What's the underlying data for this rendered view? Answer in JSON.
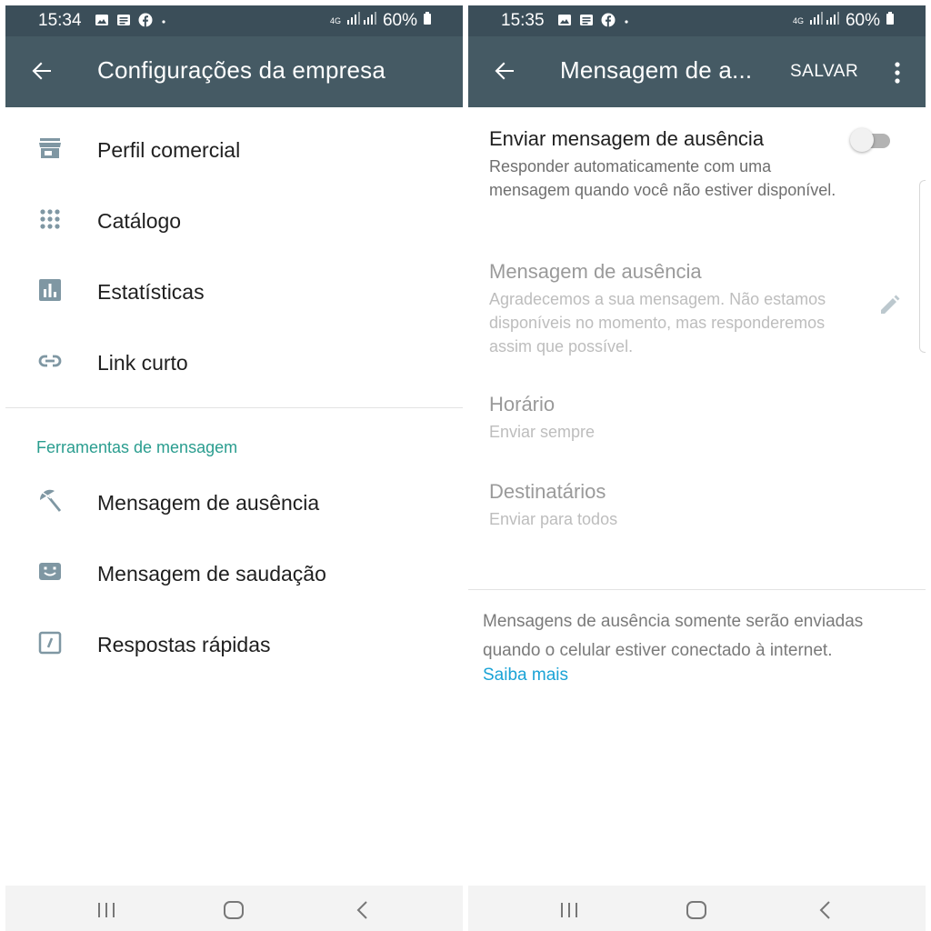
{
  "left": {
    "status": {
      "time": "15:34",
      "network": "4G",
      "battery": "60%"
    },
    "appbar": {
      "title": "Configurações da empresa"
    },
    "items": [
      {
        "label": "Perfil comercial",
        "icon": "store-icon"
      },
      {
        "label": "Catálogo",
        "icon": "grid-icon"
      },
      {
        "label": "Estatísticas",
        "icon": "bar-chart-icon"
      },
      {
        "label": "Link curto",
        "icon": "link-icon"
      }
    ],
    "section_label": "Ferramentas de mensagem",
    "tools": [
      {
        "label": "Mensagem de ausência",
        "icon": "beach-umbrella-icon"
      },
      {
        "label": "Mensagem de saudação",
        "icon": "greeting-icon"
      },
      {
        "label": "Respostas rápidas",
        "icon": "quick-reply-icon"
      }
    ]
  },
  "right": {
    "status": {
      "time": "15:35",
      "network": "4G",
      "battery": "60%"
    },
    "appbar": {
      "title": "Mensagem de a...",
      "save_label": "SALVAR"
    },
    "toggle": {
      "title": "Enviar mensagem de ausência",
      "subtitle": "Responder automaticamente com uma mensagem quando você não estiver disponível.",
      "enabled": false
    },
    "message": {
      "title": "Mensagem de ausência",
      "text": "Agradecemos a sua mensagem. Não estamos disponíveis no momento, mas responderemos assim que possível."
    },
    "schedule": {
      "title": "Horário",
      "value": "Enviar sempre"
    },
    "recipients": {
      "title": "Destinatários",
      "value": "Enviar para todos"
    },
    "footnote": "Mensagens de ausência somente serão enviadas quando o celular estiver conectado à internet.",
    "learn_more": "Saiba mais"
  },
  "colors": {
    "statusbar": "#3b4e59",
    "appbar": "#455a64",
    "accent": "#2a9d8f",
    "icon": "#7f97a3",
    "link": "#1aa3d6"
  }
}
